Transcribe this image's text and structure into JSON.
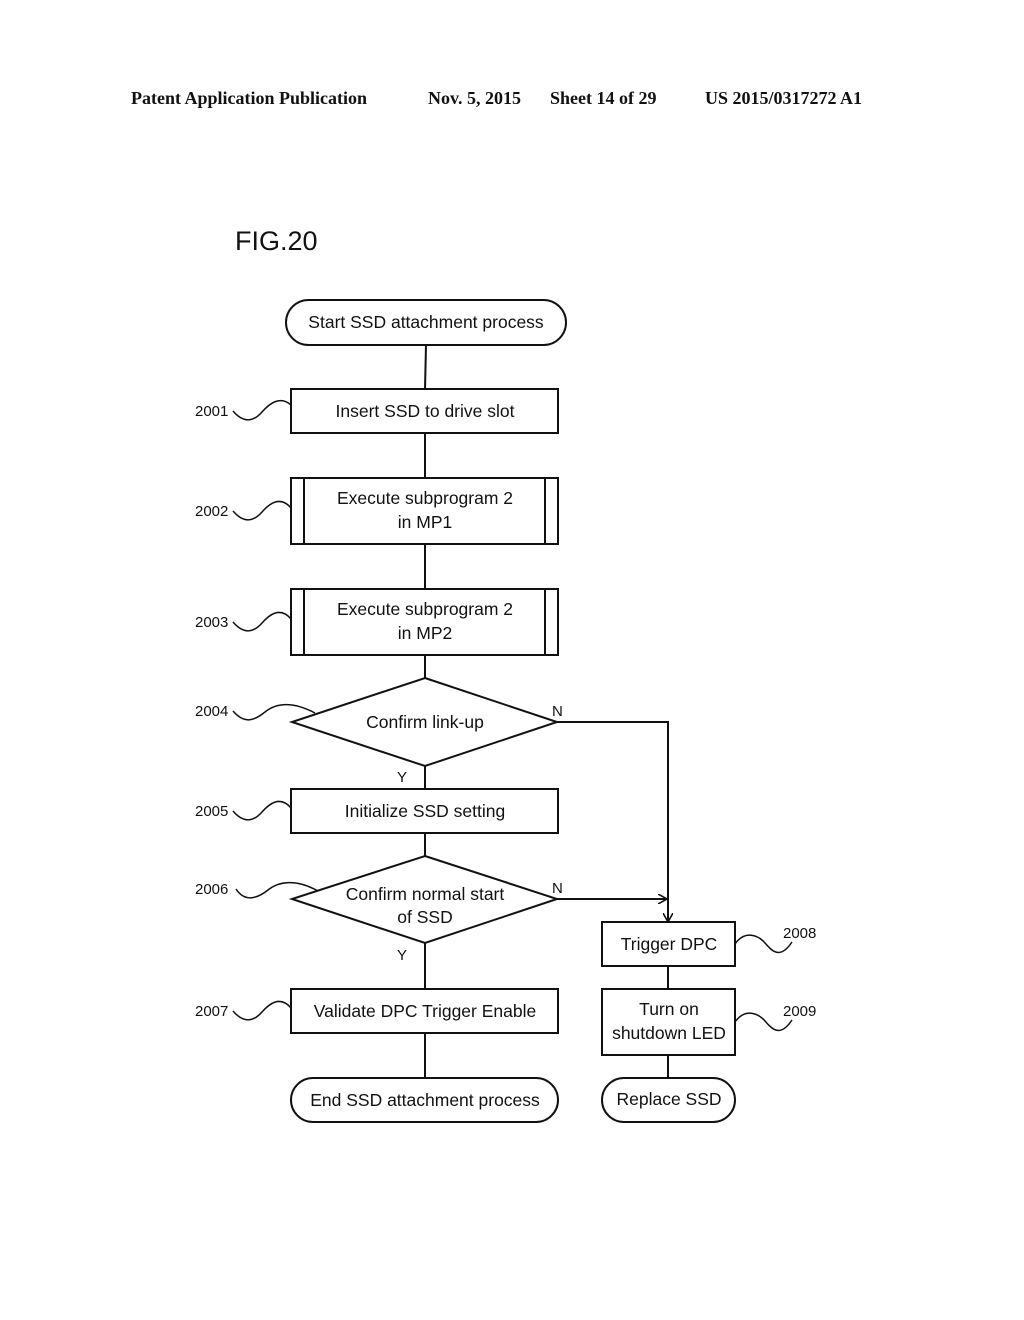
{
  "header": {
    "publication": "Patent Application Publication",
    "date": "Nov. 5, 2015",
    "sheet": "Sheet 14 of 29",
    "number": "US 2015/0317272 A1"
  },
  "figure": {
    "title": "FIG.20"
  },
  "nodes": {
    "start": {
      "type": "terminal",
      "lines": [
        "Start SSD attachment process"
      ]
    },
    "n2001": {
      "type": "process",
      "ref": "2001",
      "lines": [
        "Insert SSD to drive slot"
      ]
    },
    "n2002": {
      "type": "subprocess",
      "ref": "2002",
      "lines": [
        "Execute subprogram 2",
        "in MP1"
      ]
    },
    "n2003": {
      "type": "subprocess",
      "ref": "2003",
      "lines": [
        "Execute subprogram 2",
        "in MP2"
      ]
    },
    "n2004": {
      "type": "decision",
      "ref": "2004",
      "lines": [
        "Confirm link-up"
      ],
      "yes": "Y",
      "no": "N"
    },
    "n2005": {
      "type": "process",
      "ref": "2005",
      "lines": [
        "Initialize SSD setting"
      ]
    },
    "n2006": {
      "type": "decision",
      "ref": "2006",
      "lines": [
        "Confirm normal start",
        "of SSD"
      ],
      "yes": "Y",
      "no": "N"
    },
    "n2007": {
      "type": "process",
      "ref": "2007",
      "lines": [
        "Validate DPC Trigger Enable"
      ]
    },
    "end": {
      "type": "terminal",
      "lines": [
        "End SSD attachment process"
      ]
    },
    "n2008": {
      "type": "process",
      "ref": "2008",
      "lines": [
        "Trigger DPC"
      ]
    },
    "n2009": {
      "type": "process",
      "ref": "2009",
      "lines": [
        "Turn on",
        "shutdown LED"
      ]
    },
    "replace": {
      "type": "terminal",
      "lines": [
        "Replace SSD"
      ]
    }
  }
}
